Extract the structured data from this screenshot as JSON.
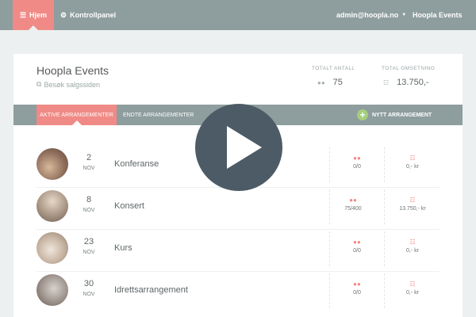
{
  "nav": {
    "home_label": "Hjem",
    "panel_label": "Kontrollpanel",
    "user_label": "admin@hoopla.no",
    "brand_label": "Hoopla Events"
  },
  "header": {
    "title": "Hoopla Events",
    "link_label": "Besøk salgssiden",
    "stats": {
      "count_label": "TOTALT ANTALL",
      "count_value": "75",
      "revenue_label": "TOTAL OMSETNING",
      "revenue_value": "13.750,-"
    }
  },
  "tabs": {
    "active_label": "AKTIVE ARRANGEMENTER",
    "ended_label": "ENDTE ARRANGEMENTER",
    "new_label": "NYTT ARRANGEMENT"
  },
  "events": [
    {
      "day": "2",
      "month": "NOV",
      "name": "Konferanse",
      "tickets": "0/0",
      "revenue": "0,- kr"
    },
    {
      "day": "8",
      "month": "NOV",
      "name": "Konsert",
      "tickets": "75/400",
      "revenue": "13.750,- kr"
    },
    {
      "day": "23",
      "month": "NOV",
      "name": "Kurs",
      "tickets": "0/0",
      "revenue": "0,- kr"
    },
    {
      "day": "30",
      "month": "NOV",
      "name": "Idrettsarrangement",
      "tickets": "0/0",
      "revenue": "0,- kr"
    }
  ],
  "colors": {
    "accent": "#f08a86",
    "nav_bg": "#8e9d9e",
    "page_bg": "#ecf0f0",
    "play_bg": "#4d5b66",
    "plus_bg": "#a3cf7c"
  },
  "icons": {
    "menu": "menu-icon",
    "gear": "gear-icon",
    "users": "users-icon",
    "database": "database-icon",
    "external_link": "external-link-icon",
    "play": "play-icon"
  }
}
